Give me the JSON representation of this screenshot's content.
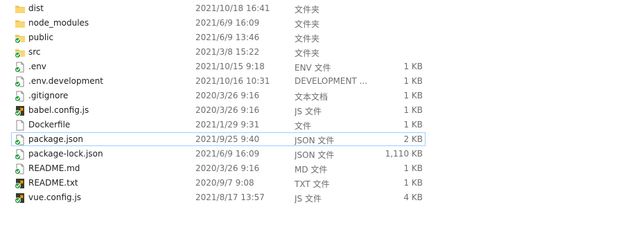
{
  "files": [
    {
      "name": "dist",
      "date": "2021/10/18 16:41",
      "type": "文件夹",
      "size": "",
      "icon": "folder-icon"
    },
    {
      "name": "node_modules",
      "date": "2021/6/9 16:09",
      "type": "文件夹",
      "size": "",
      "icon": "folder-icon"
    },
    {
      "name": "public",
      "date": "2021/6/9 13:46",
      "type": "文件夹",
      "size": "",
      "icon": "folder-synced-icon"
    },
    {
      "name": "src",
      "date": "2021/3/8 15:22",
      "type": "文件夹",
      "size": "",
      "icon": "folder-synced-icon"
    },
    {
      "name": ".env",
      "date": "2021/10/15 9:18",
      "type": "ENV 文件",
      "size": "1 KB",
      "icon": "file-synced-icon"
    },
    {
      "name": ".env.development",
      "date": "2021/10/16 10:31",
      "type": "DEVELOPMENT ...",
      "size": "1 KB",
      "icon": "file-synced-icon"
    },
    {
      "name": ".gitignore",
      "date": "2020/3/26 9:16",
      "type": "文本文档",
      "size": "1 KB",
      "icon": "file-synced-icon"
    },
    {
      "name": "babel.config.js",
      "date": "2020/3/26 9:16",
      "type": "JS 文件",
      "size": "1 KB",
      "icon": "js-file-synced-icon"
    },
    {
      "name": "Dockerfile",
      "date": "2021/1/29 9:31",
      "type": "文件",
      "size": "1 KB",
      "icon": "file-icon"
    },
    {
      "name": "package.json",
      "date": "2021/9/25 9:40",
      "type": "JSON 文件",
      "size": "2 KB",
      "icon": "file-synced-icon"
    },
    {
      "name": "package-lock.json",
      "date": "2021/6/9 16:09",
      "type": "JSON 文件",
      "size": "1,110 KB",
      "icon": "file-synced-icon"
    },
    {
      "name": "README.md",
      "date": "2020/3/26 9:16",
      "type": "MD 文件",
      "size": "1 KB",
      "icon": "file-synced-icon"
    },
    {
      "name": "README.txt",
      "date": "2020/9/7 9:08",
      "type": "TXT 文件",
      "size": "1 KB",
      "icon": "js-file-synced-icon"
    },
    {
      "name": "vue.config.js",
      "date": "2021/8/17 13:57",
      "type": "JS 文件",
      "size": "4 KB",
      "icon": "js-file-synced-icon"
    }
  ],
  "selected_index": 9,
  "colors": {
    "folder": "#f8d775",
    "folder_dark": "#e8b94a",
    "sync_green": "#2ea043",
    "js_dark": "#3a3a2a",
    "js_arrow": "#f0a000",
    "selection_border": "#99d1ff"
  }
}
